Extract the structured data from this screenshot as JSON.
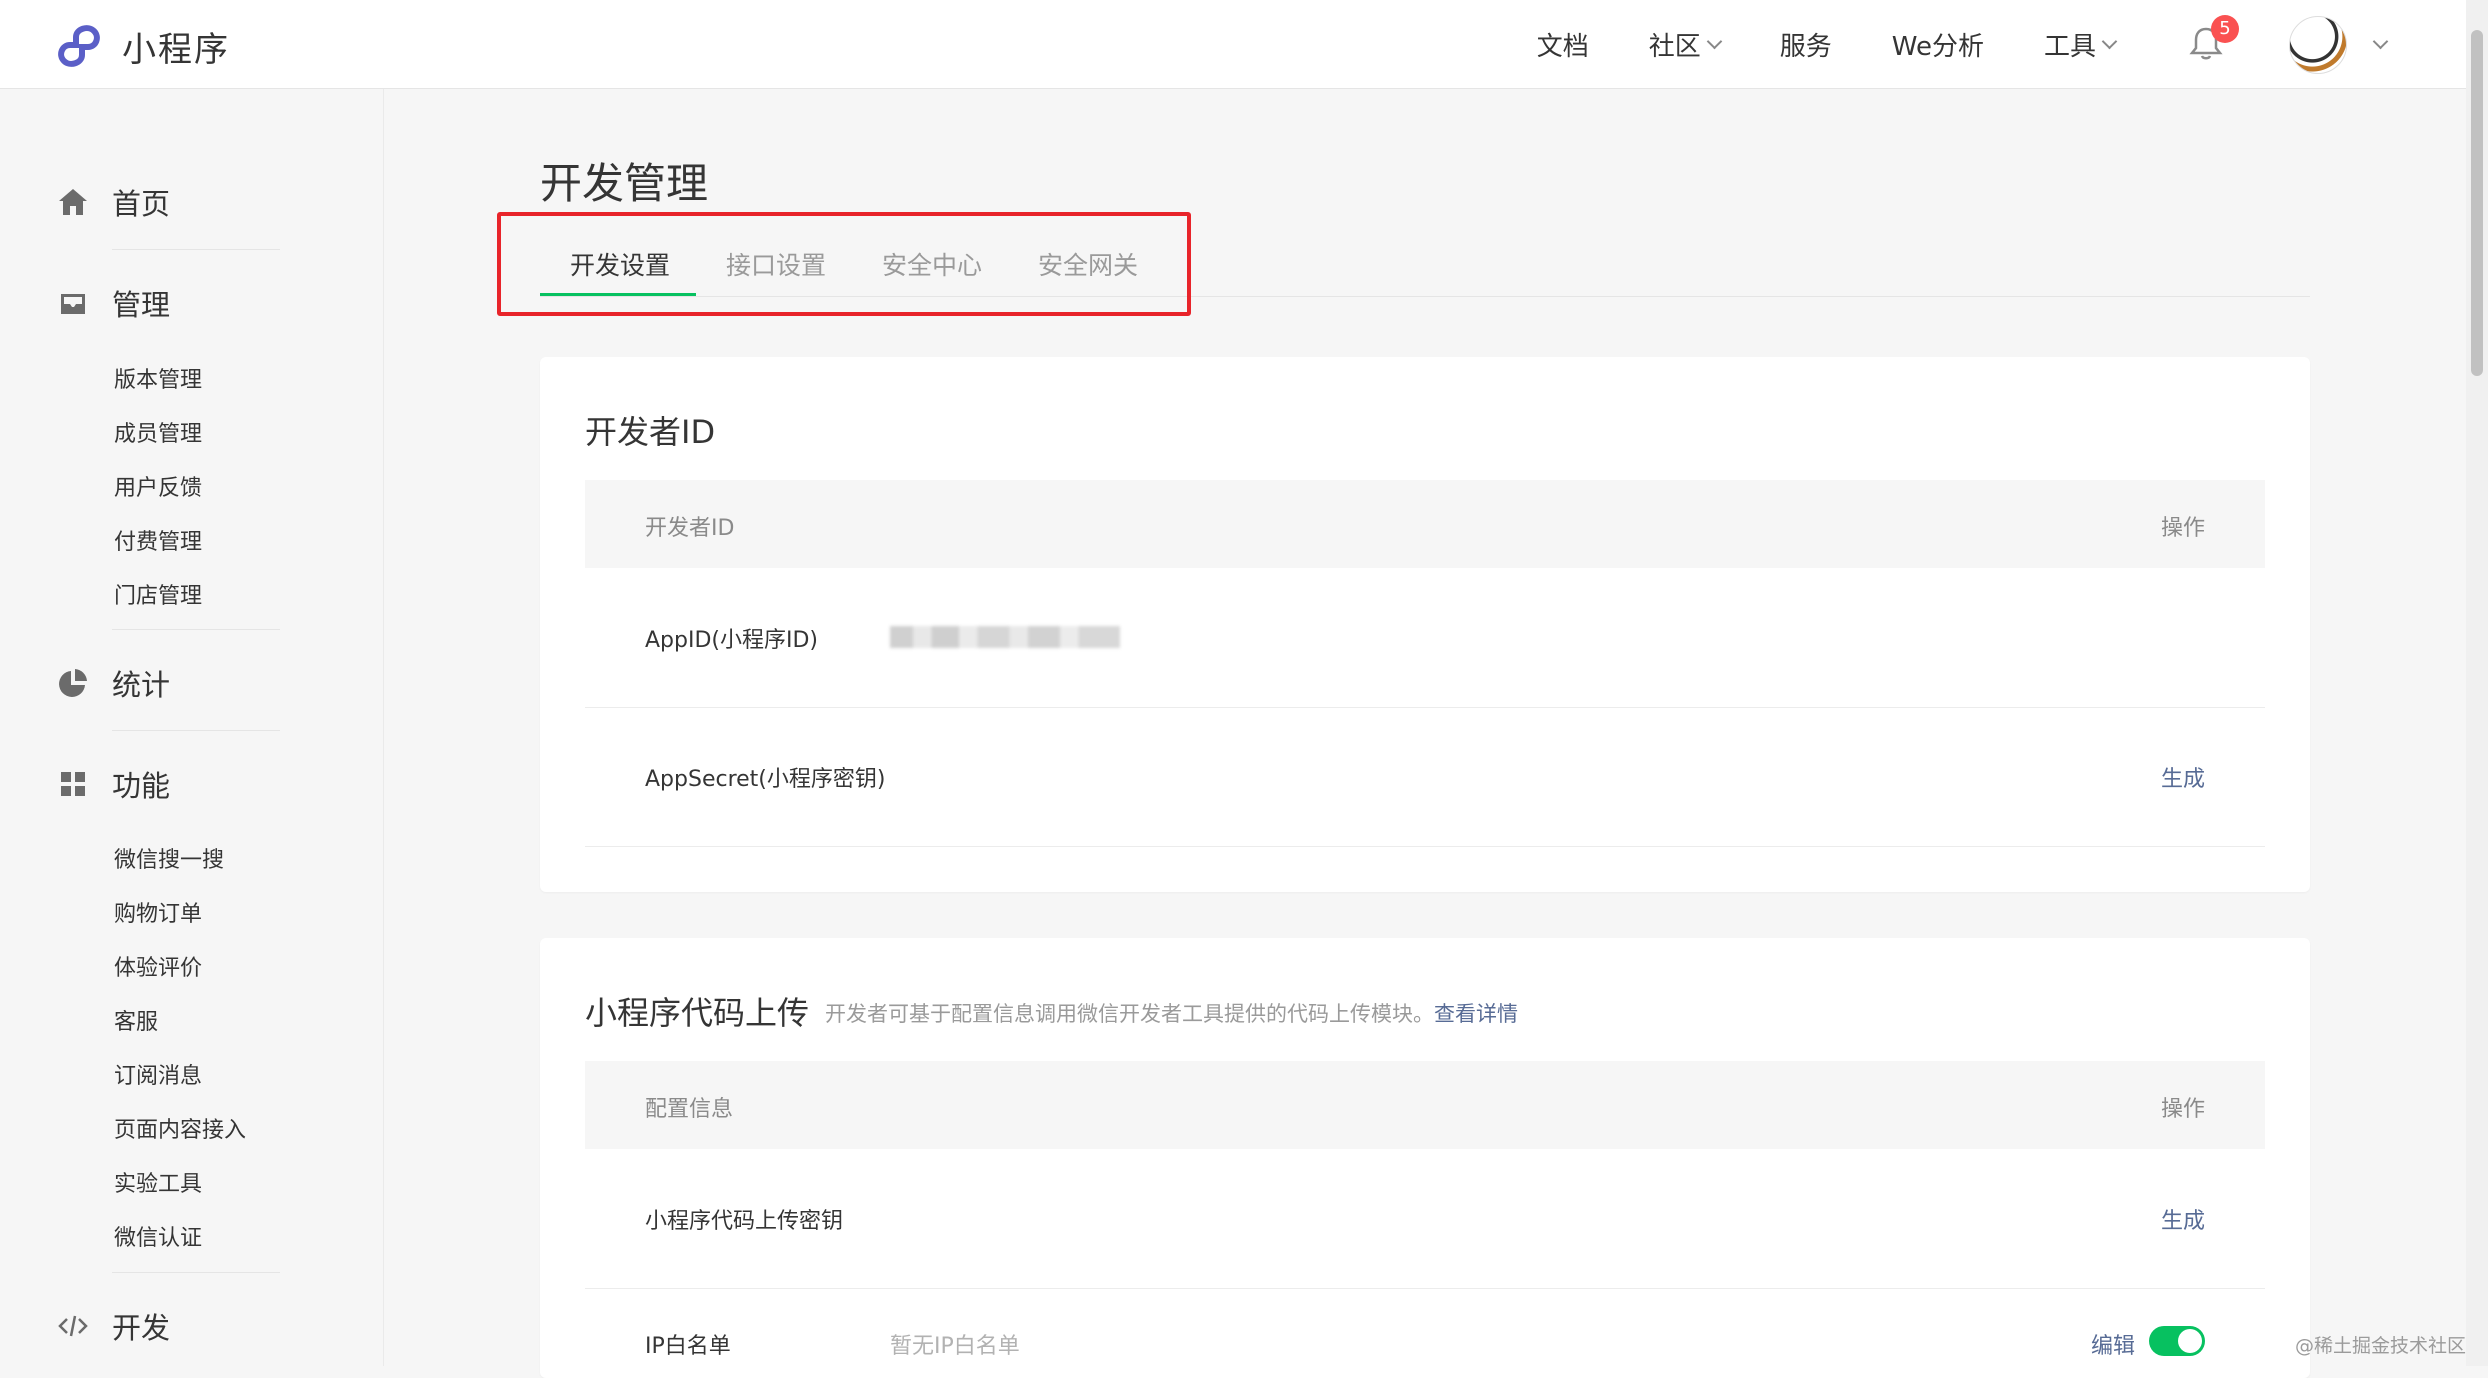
{
  "app": {
    "name": "小程序",
    "brand_color": "#5b5fc7",
    "accent_color": "#07c160"
  },
  "topnav": {
    "items": [
      "文档",
      "社区",
      "服务",
      "We分析",
      "工具"
    ],
    "notification_count": "5"
  },
  "sidebar": {
    "home": "首页",
    "manage": {
      "label": "管理",
      "items": [
        "版本管理",
        "成员管理",
        "用户反馈",
        "付费管理",
        "门店管理"
      ]
    },
    "stats": "统计",
    "features": {
      "label": "功能",
      "items": [
        "微信搜一搜",
        "购物订单",
        "体验评价",
        "客服",
        "订阅消息",
        "页面内容接入",
        "实验工具",
        "微信认证"
      ]
    },
    "dev": "开发"
  },
  "main": {
    "title": "开发管理",
    "tabs": [
      "开发设置",
      "接口设置",
      "安全中心",
      "安全网关"
    ],
    "developer_card": {
      "title": "开发者ID",
      "col_left": "开发者ID",
      "col_right": "操作",
      "rows": [
        {
          "label": "AppID(小程序ID)",
          "action": ""
        },
        {
          "label": "AppSecret(小程序密钥)",
          "action": "生成"
        }
      ]
    },
    "upload_card": {
      "title": "小程序代码上传",
      "desc": "开发者可基于配置信息调用微信开发者工具提供的代码上传模块。",
      "desc_link": "查看详情",
      "col_left": "配置信息",
      "col_right": "操作",
      "rows": [
        {
          "label": "小程序代码上传密钥",
          "action": "生成"
        },
        {
          "label": "IP白名单",
          "value": "暂无IP白名单",
          "action": "编辑"
        }
      ]
    }
  },
  "watermark": "@稀土掘金技术社区"
}
